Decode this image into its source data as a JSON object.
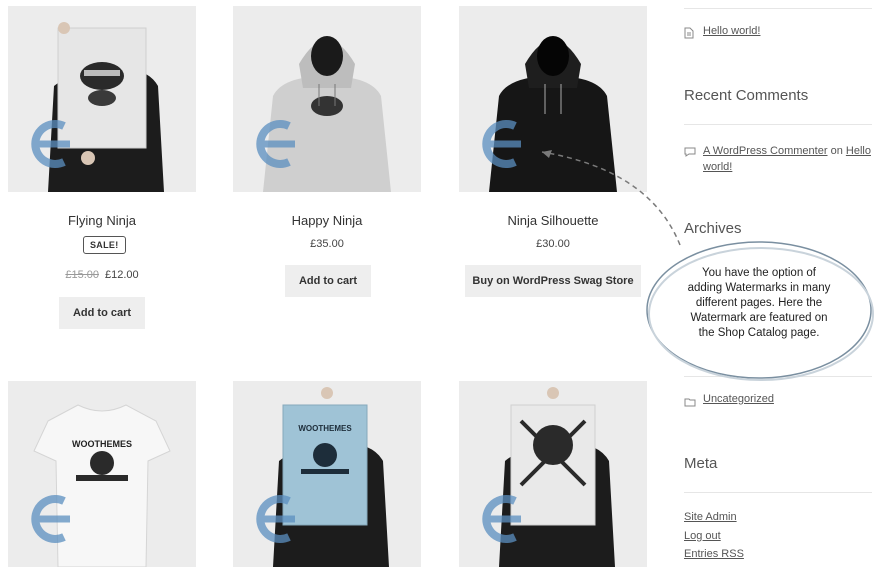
{
  "products": [
    {
      "title": "Flying Ninja",
      "sale_badge": "SALE!",
      "old_price": "£15.00",
      "price": "£12.00",
      "button": "Add to cart"
    },
    {
      "title": "Happy Ninja",
      "price": "£35.00",
      "button": "Add to cart"
    },
    {
      "title": "Ninja Silhouette",
      "price": "£30.00",
      "button": "Buy on WordPress Swag Store"
    }
  ],
  "sidebar": {
    "recent_post": "Hello world!",
    "recent_comments_title": "Recent Comments",
    "comment": {
      "author": "A WordPress Commenter",
      "on": "on",
      "post_line1": "Hello",
      "post_line2": "world!"
    },
    "archives_title": "Archives",
    "category": "Uncategorized",
    "meta_title": "Meta",
    "meta_links": [
      "Site Admin",
      "Log out",
      "Entries RSS"
    ]
  },
  "callout": {
    "lines": [
      "You have the option of",
      "adding Watermarks in many",
      "different pages. Here the",
      "Watermark are featured on",
      "the Shop Catalog page."
    ]
  },
  "colors": {
    "watermark": "#5b8fc0",
    "image_bg": "#ececec",
    "button_bg": "#eeeeee"
  }
}
